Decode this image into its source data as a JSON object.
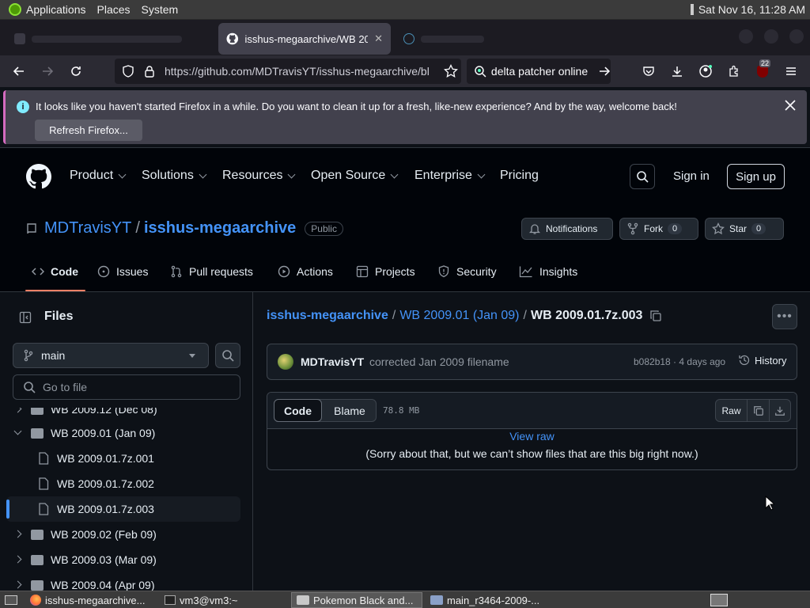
{
  "system_bar": {
    "menus": [
      "Applications",
      "Places",
      "System"
    ],
    "clock": "Sat Nov 16, 11:28 AM"
  },
  "browser": {
    "tabs": [
      {
        "label": "isshus-megaarchive/WB 20"
      }
    ],
    "url": "https://github.com/MDTravisYT/isshus-megaarchive/bl",
    "search_text": "delta patcher online",
    "extension_badge": "22",
    "notification": {
      "message": "It looks like you haven't started Firefox in a while. Do you want to clean it up for a fresh, like-new experience? And by the way, welcome back!",
      "button": "Refresh Firefox..."
    }
  },
  "github_header": {
    "nav": [
      "Product",
      "Solutions",
      "Resources",
      "Open Source",
      "Enterprise",
      "Pricing"
    ],
    "sign_in": "Sign in",
    "sign_up": "Sign up"
  },
  "repo": {
    "owner": "MDTravisYT",
    "separator": "/",
    "name": "isshus-megaarchive",
    "visibility": "Public",
    "notifications_label": "Notifications",
    "fork_label": "Fork",
    "fork_count": "0",
    "star_label": "Star",
    "star_count": "0",
    "tabs": [
      "Code",
      "Issues",
      "Pull requests",
      "Actions",
      "Projects",
      "Security",
      "Insights"
    ]
  },
  "sidebar": {
    "title": "Files",
    "branch": "main",
    "search_placeholder": "Go to file",
    "tree": [
      {
        "label": "WB 2009.12 (Dec 08)",
        "type": "folder",
        "expanded": false,
        "level": 0
      },
      {
        "label": "WB 2009.01 (Jan 09)",
        "type": "folder",
        "expanded": true,
        "level": 0
      },
      {
        "label": "WB 2009.01.7z.001",
        "type": "file",
        "level": 1
      },
      {
        "label": "WB 2009.01.7z.002",
        "type": "file",
        "level": 1
      },
      {
        "label": "WB 2009.01.7z.003",
        "type": "file",
        "level": 1,
        "selected": true
      },
      {
        "label": "WB 2009.02 (Feb 09)",
        "type": "folder",
        "expanded": false,
        "level": 0
      },
      {
        "label": "WB 2009.03 (Mar 09)",
        "type": "folder",
        "expanded": false,
        "level": 0
      },
      {
        "label": "WB 2009.04 (Apr 09)",
        "type": "folder",
        "expanded": false,
        "level": 0
      }
    ]
  },
  "file_view": {
    "breadcrumb": {
      "repo": "isshus-megaarchive",
      "sep1": "/",
      "folder": "WB 2009.01 (Jan 09)",
      "sep2": "/",
      "file": "WB 2009.01.7z.003"
    },
    "commit": {
      "author": "MDTravisYT",
      "message": "corrected Jan 2009 filename",
      "hash_time": "b082b18 · 4 days ago",
      "history": "History"
    },
    "toolbar": {
      "code_tab": "Code",
      "blame_tab": "Blame",
      "size": "78.8 MB",
      "raw": "Raw"
    },
    "view_raw": "View raw",
    "too_big": "(Sorry about that, but we can’t show files that are this big right now.)"
  },
  "taskbar": {
    "items": [
      "isshus-megaarchive...",
      "vm3@vm3:~",
      "Pokemon Black and...",
      "main_r3464-2009-..."
    ]
  },
  "colors": {
    "accent_blue": "#4493f8",
    "tab_underline": "#f78166",
    "selected_marker": "#4493f8"
  }
}
